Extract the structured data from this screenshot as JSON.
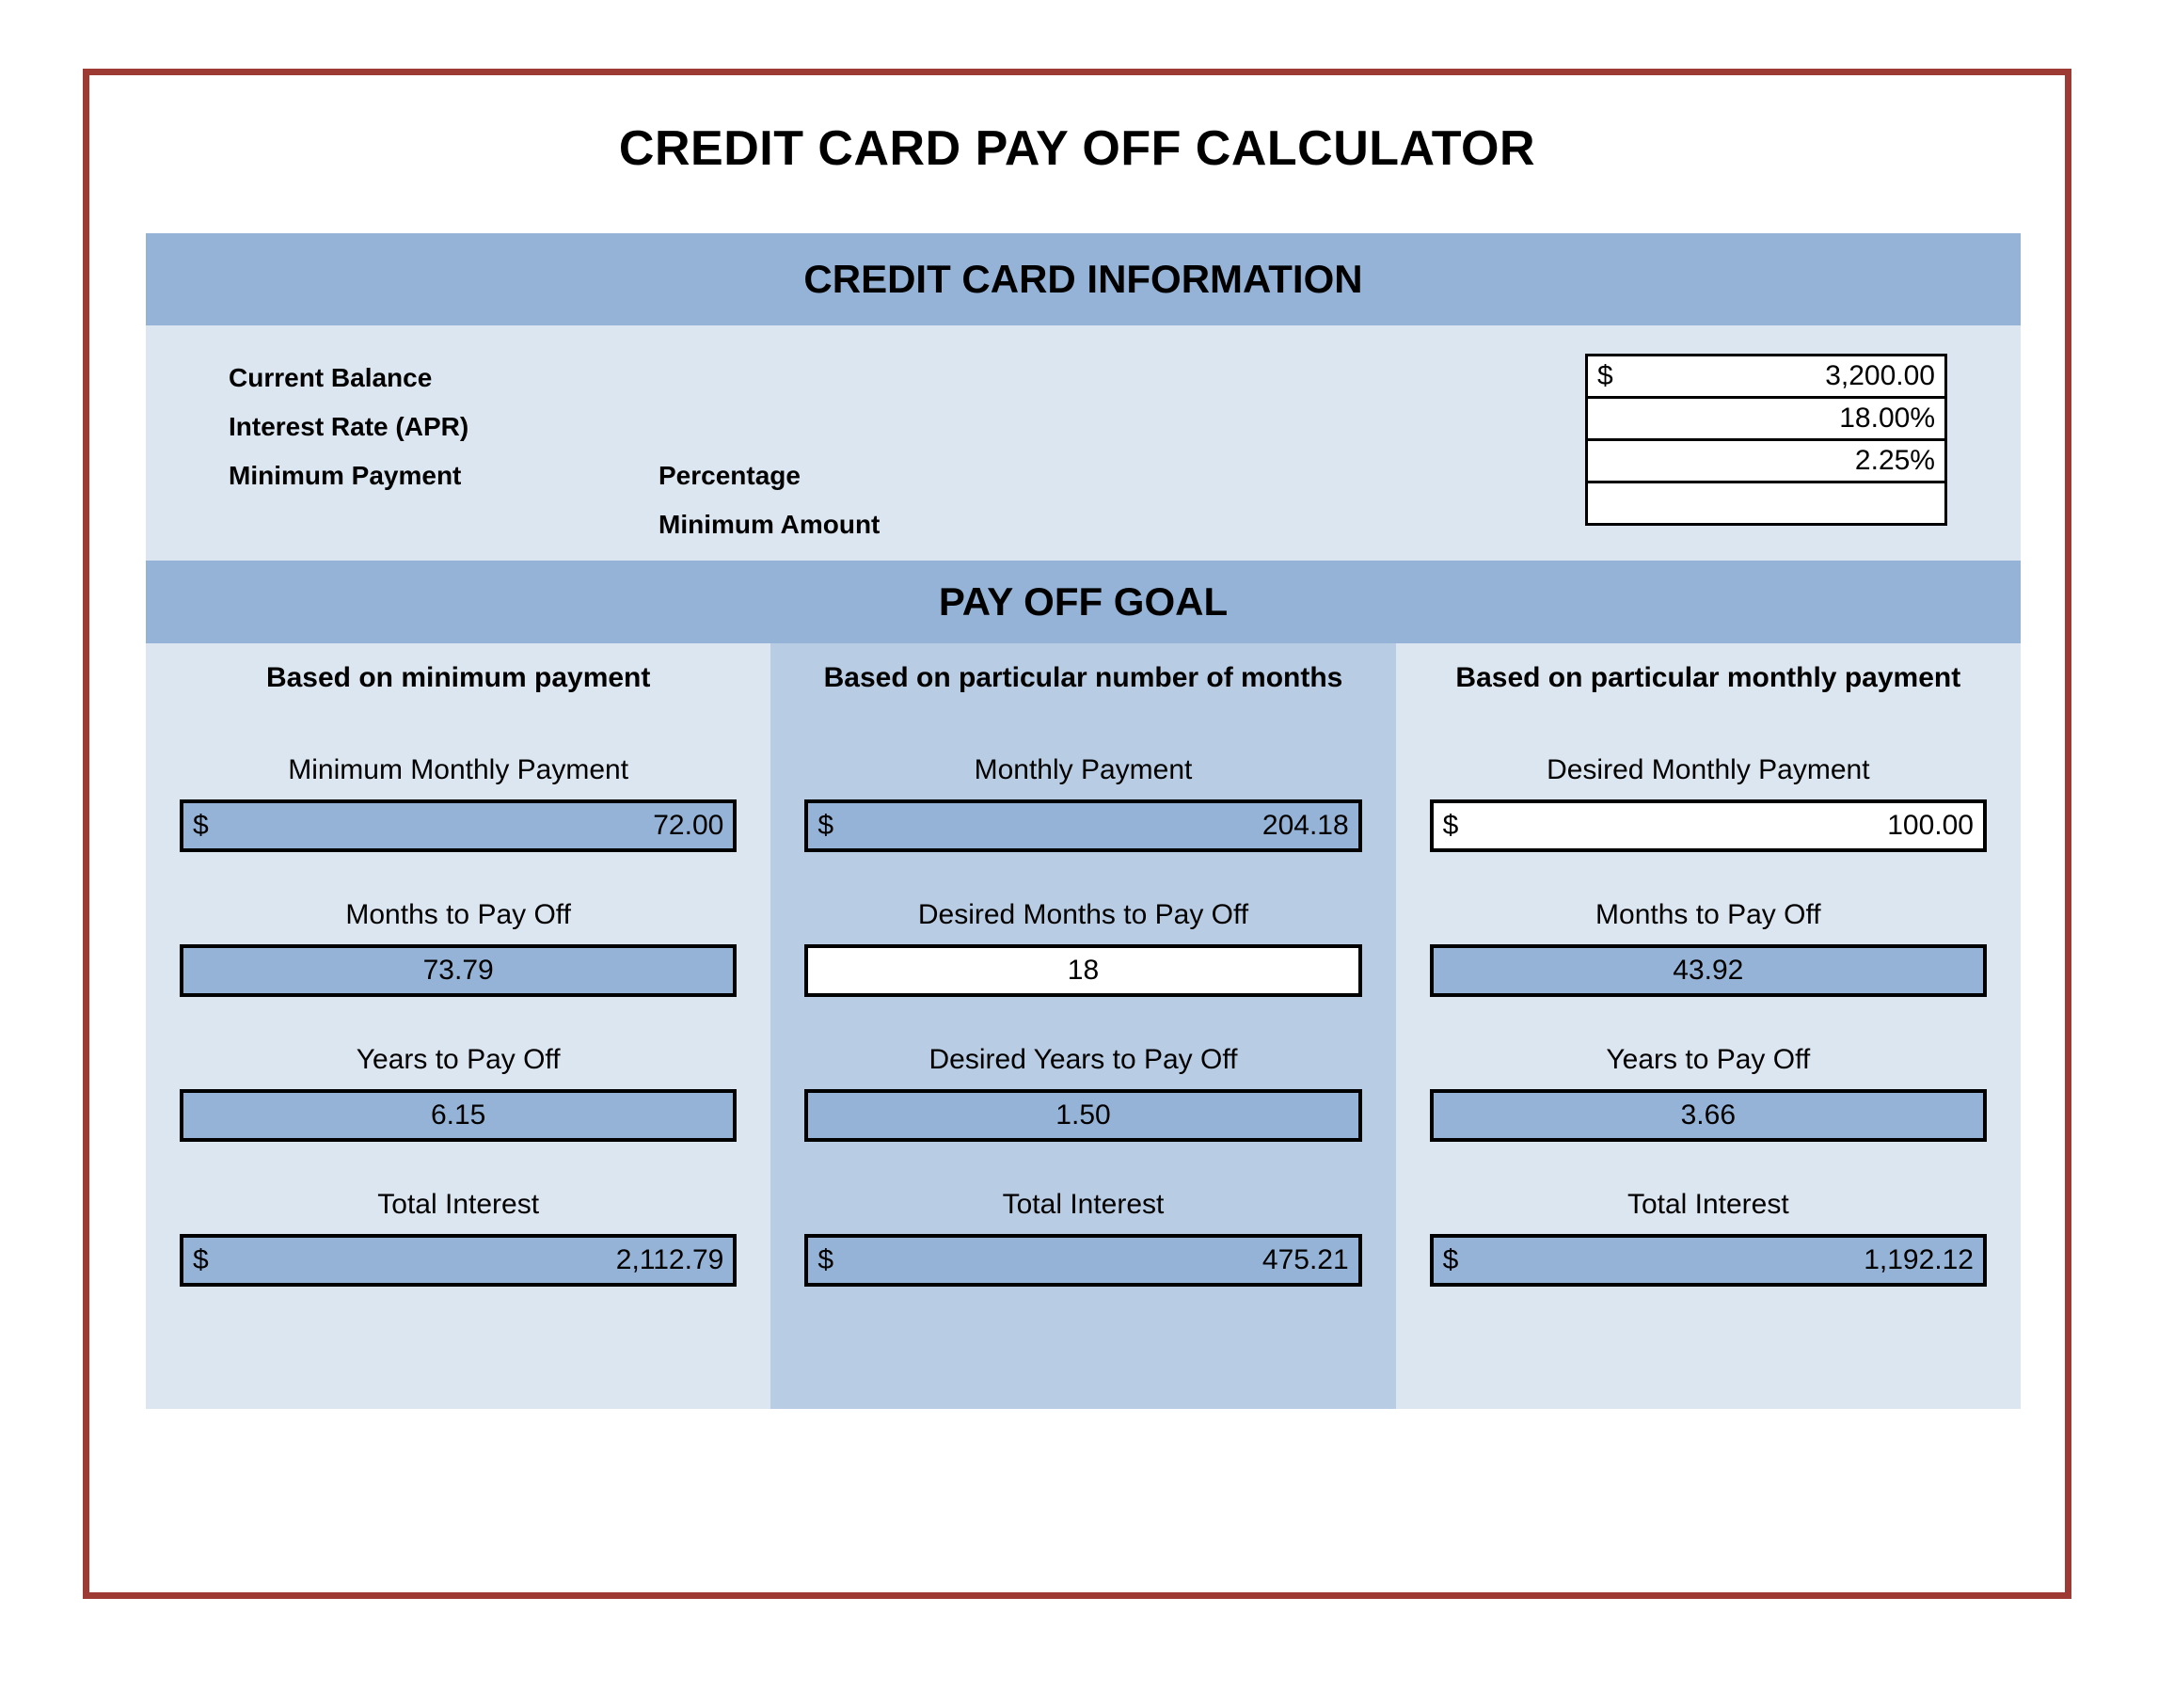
{
  "title": "CREDIT CARD PAY OFF CALCULATOR",
  "credit_card_information": {
    "header": "CREDIT CARD INFORMATION",
    "labels": {
      "current_balance": "Current Balance",
      "interest_rate": "Interest Rate (APR)",
      "minimum_payment": "Minimum Payment",
      "percentage": "Percentage",
      "minimum_amount": "Minimum Amount"
    },
    "inputs": [
      {
        "currency": "$",
        "value": "3,200.00"
      },
      {
        "currency": "",
        "value": "18.00%"
      },
      {
        "currency": "",
        "value": "2.25%"
      },
      {
        "currency": "",
        "value": ""
      }
    ]
  },
  "pay_off_goal": {
    "header": "PAY OFF GOAL",
    "columns": [
      {
        "title": "Based on minimum payment",
        "rows": [
          {
            "label": "Minimum Monthly Payment",
            "currency": "$",
            "value": "72.00",
            "editable": false,
            "align": "right"
          },
          {
            "label": "Months to Pay Off",
            "currency": "",
            "value": "73.79",
            "editable": false,
            "align": "center"
          },
          {
            "label": "Years to Pay Off",
            "currency": "",
            "value": "6.15",
            "editable": false,
            "align": "center"
          },
          {
            "label": "Total Interest",
            "currency": "$",
            "value": "2,112.79",
            "editable": false,
            "align": "right"
          }
        ]
      },
      {
        "title": "Based on particular number of months",
        "rows": [
          {
            "label": "Monthly Payment",
            "currency": "$",
            "value": "204.18",
            "editable": false,
            "align": "right"
          },
          {
            "label": "Desired Months to Pay Off",
            "currency": "",
            "value": "18",
            "editable": true,
            "align": "center"
          },
          {
            "label": "Desired Years to Pay Off",
            "currency": "",
            "value": "1.50",
            "editable": false,
            "align": "center"
          },
          {
            "label": "Total Interest",
            "currency": "$",
            "value": "475.21",
            "editable": false,
            "align": "right"
          }
        ]
      },
      {
        "title": "Based on particular monthly payment",
        "rows": [
          {
            "label": "Desired Monthly Payment",
            "currency": "$",
            "value": "100.00",
            "editable": true,
            "align": "right"
          },
          {
            "label": "Months to Pay Off",
            "currency": "",
            "value": "43.92",
            "editable": false,
            "align": "center"
          },
          {
            "label": "Years to Pay Off",
            "currency": "",
            "value": "3.66",
            "editable": false,
            "align": "center"
          },
          {
            "label": "Total Interest",
            "currency": "$",
            "value": "1,192.12",
            "editable": false,
            "align": "right"
          }
        ]
      }
    ]
  },
  "colors": {
    "frame_border": "#9e3a34",
    "band_header": "#95b3d7",
    "panel_light": "#dce6f1",
    "panel_alt": "#b8cce4",
    "value_box": "#95b3d7",
    "input_box": "#ffffff"
  }
}
